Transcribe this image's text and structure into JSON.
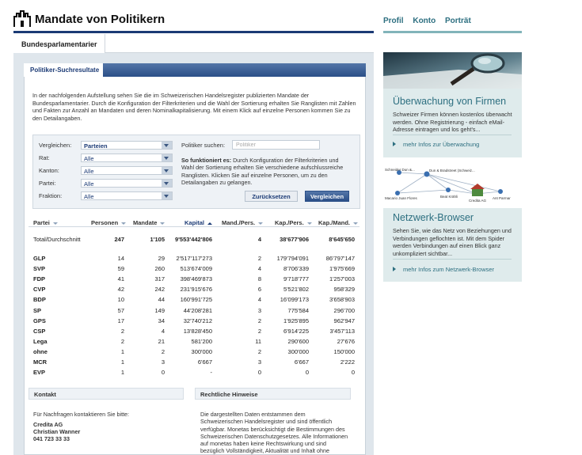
{
  "header": {
    "title": "Mandate von Politikern",
    "nav": [
      "Profil",
      "Konto",
      "Porträt"
    ]
  },
  "tabs": {
    "main": "Bundesparlamentarier",
    "results": "Politiker-Suchresultate"
  },
  "intro": "In der nachfolgenden Aufstellung sehen Sie die im Schweizerischen Handelsregister publizierten Mandate der Bundesparlamentarier. Durch die Konfiguration der Filterkriterien und die Wahl der Sortierung erhalten Sie Ranglisten mit Zahlen und Fakten zur Anzahl an Mandaten und deren Nominalkapitalisierung. Mit einem Klick auf einzelne Personen kommen Sie zu den Detailangaben.",
  "filters": {
    "items": [
      {
        "label": "Vergleichen:",
        "value": "Parteien"
      },
      {
        "label": "Rat:",
        "value": "Alle"
      },
      {
        "label": "Kanton:",
        "value": "Alle"
      },
      {
        "label": "Partei:",
        "value": "Alle"
      },
      {
        "label": "Fraktion:",
        "value": "Alle"
      }
    ],
    "search_label": "Politiker suchen:",
    "search_placeholder": "Politiker",
    "howto_title": "So funktioniert es:",
    "howto_text": " Durch Konfiguration der Filterkriterien und Wahl der Sortierung erhalten Sie verschiedene aufschlussreiche Ranglisten. Klicken Sie auf einzelne Personen, um zu den Detailangaben zu gelangen.",
    "reset_label": "Zurücksetzen",
    "compare_label": "Vergleichen"
  },
  "table": {
    "headers": [
      "Partei",
      "Personen",
      "Mandate",
      "Kapital",
      "Mand./Pers.",
      "Kap./Pers.",
      "Kap./Mand."
    ],
    "total": [
      "Total/Durchschnitt",
      "247",
      "1'105",
      "9'553'442'806",
      "4",
      "38'677'906",
      "8'645'650"
    ],
    "rows": [
      [
        "GLP",
        "14",
        "29",
        "2'517'117'273",
        "2",
        "179'794'091",
        "86'797'147"
      ],
      [
        "SVP",
        "59",
        "260",
        "513'674'009",
        "4",
        "8'706'339",
        "1'975'669"
      ],
      [
        "FDP",
        "41",
        "317",
        "398'469'873",
        "8",
        "9'718'777",
        "1'257'003"
      ],
      [
        "CVP",
        "42",
        "242",
        "231'915'676",
        "6",
        "5'521'802",
        "958'329"
      ],
      [
        "BDP",
        "10",
        "44",
        "160'991'725",
        "4",
        "16'099'173",
        "3'658'903"
      ],
      [
        "SP",
        "57",
        "149",
        "44'208'281",
        "3",
        "775'584",
        "296'700"
      ],
      [
        "GPS",
        "17",
        "34",
        "32'740'212",
        "2",
        "1'925'895",
        "962'947"
      ],
      [
        "CSP",
        "2",
        "4",
        "13'828'450",
        "2",
        "6'914'225",
        "3'457'113"
      ],
      [
        "Lega",
        "2",
        "21",
        "581'200",
        "11",
        "290'600",
        "27'676"
      ],
      [
        "ohne",
        "1",
        "2",
        "300'000",
        "2",
        "300'000",
        "150'000"
      ],
      [
        "MCR",
        "1",
        "3",
        "6'667",
        "3",
        "6'667",
        "2'222"
      ],
      [
        "EVP",
        "1",
        "0",
        "-",
        "0",
        "0",
        "0"
      ]
    ]
  },
  "contact": {
    "title": "Kontakt",
    "intro": "Für Nachfragen kontaktieren Sie bitte:",
    "company": "Credita AG",
    "person": "Christian Wanner",
    "phone": "041 723 33 33"
  },
  "legal": {
    "title": "Rechtliche Hinweise",
    "text": "Die dargestellten Daten entstammen dem Schweizerischen Handelsregister und sind öffentlich verfügbar. Monetas berücksichtigt die Bestimmungen des Schweizerischen Datenschutzgesetzes. Alle Informationen auf monetas haben keine Rechtswirkung und sind bezüglich Vollständigkeit, Aktualität und Inhalt ohne Gewähr."
  },
  "sidebar": {
    "card1": {
      "title": "Überwachung von Firmen",
      "text": "Schweizer Firmen können kostenlos überwacht werden. Ohne Registrierung - einfach eMail-Adresse eintragen und los geht's...",
      "link": "mehr Infos zur Überwachung"
    },
    "card2": {
      "title": "Netzwerk-Browser",
      "text": "Sehen Sie, wie das Netz von Beziehungen und Verbindungen geflochten ist. Mit dem Spider werden Verbindungen auf einen Blick ganz unkompliziert sichtbar...",
      "link": "mehr Infos zum Netzwerk-Browser",
      "nodes": [
        "Dun & Bradstreet (Schweiz...",
        "Schneider Dun &...",
        "Macario Juan Flores",
        "Beat Krähli",
        "Credita AG",
        "Ant Parmar"
      ]
    }
  },
  "colors": {
    "navy": "#1b3a75",
    "teal": "#2d6f80",
    "panel": "#dfe6ec",
    "card": "#dfebec"
  }
}
